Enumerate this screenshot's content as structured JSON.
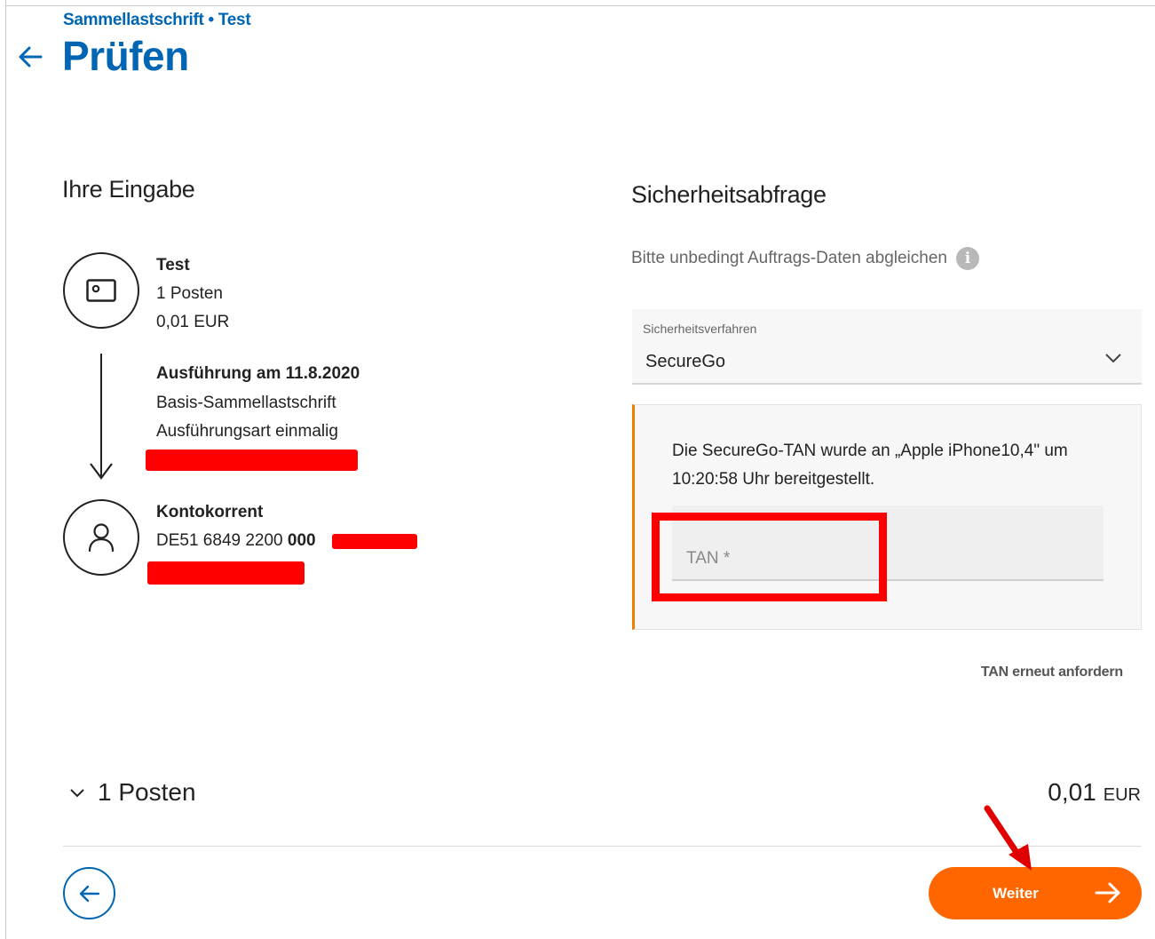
{
  "header": {
    "breadcrumb": "Sammellastschrift • Test",
    "title": "Prüfen"
  },
  "input_summary": {
    "heading": "Ihre Eingabe",
    "sender": {
      "name": "Test",
      "items": "1 Posten",
      "amount": "0,01 EUR"
    },
    "execution": {
      "title": "Ausführung am 11.8.2020",
      "type": "Basis-Sammellastschrift",
      "mode": "Ausführungsart einmalig"
    },
    "account": {
      "name": "Kontokorrent",
      "iban_visible": "DE51 6849 2200 ",
      "iban_bold": "000"
    }
  },
  "security": {
    "heading": "Sicherheitsabfrage",
    "hint": "Bitte unbedingt Auftrags-Daten abgleichen",
    "procedure_label": "Sicherheitsverfahren",
    "procedure_value": "SecureGo",
    "tan_message": "Die SecureGo-TAN wurde an „Apple iPhone10,4\" um 10:20:58 Uhr bereitgestellt.",
    "tan_placeholder": "TAN *",
    "resend_label": "TAN erneut anfordern"
  },
  "footer": {
    "items_label": "1 Posten",
    "total_amount": "0,01",
    "total_currency": "EUR",
    "next_label": "Weiter"
  },
  "colors": {
    "brand_blue": "#0066b3",
    "accent_orange": "#ff6600",
    "annotation_red": "#ff0000"
  }
}
